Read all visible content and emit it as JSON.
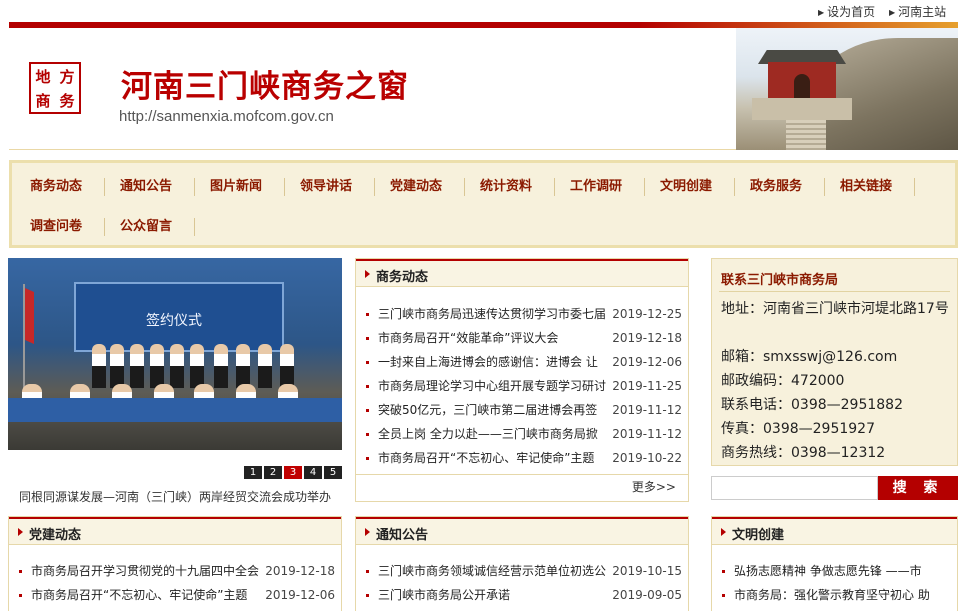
{
  "topbar": {
    "set_home": "设为首页",
    "henan_main": "河南主站"
  },
  "header": {
    "seal_chars": [
      "地",
      "方",
      "商",
      "务"
    ],
    "title": "河南三门峡商务之窗",
    "url": "http://sanmenxia.mofcom.gov.cn"
  },
  "nav": {
    "items": [
      "商务动态",
      "通知公告",
      "图片新闻",
      "领导讲话",
      "党建动态",
      "统计资料",
      "工作调研",
      "文明创建",
      "政务服务",
      "相关链接",
      "调查问卷",
      "公众留言"
    ]
  },
  "carousel": {
    "slide_title": "签约仪式",
    "pages": [
      "1",
      "2",
      "3",
      "4",
      "5"
    ],
    "active_page": "3",
    "caption": "同根同源谋发展—河南（三门峡）两岸经贸交流会成功举办"
  },
  "business_news": {
    "title": "商务动态",
    "more": "更多>>",
    "items": [
      {
        "title": "三门峡市商务局迅速传达贯彻学习市委七届",
        "date": "2019-12-25"
      },
      {
        "title": "市商务局召开“效能革命”评议大会",
        "date": "2019-12-18"
      },
      {
        "title": "一封来自上海进博会的感谢信：进博会 让",
        "date": "2019-12-06"
      },
      {
        "title": "市商务局理论学习中心组开展专题学习研讨",
        "date": "2019-11-25"
      },
      {
        "title": "突破50亿元，三门峡市第二届进博会再签",
        "date": "2019-11-12"
      },
      {
        "title": "全员上岗 全力以赴——三门峡市商务局掀",
        "date": "2019-11-12"
      },
      {
        "title": "市商务局召开“不忘初心、牢记使命”主题",
        "date": "2019-10-22"
      }
    ]
  },
  "contact": {
    "title": "联系三门峡市商务局",
    "rows": [
      "地址：河南省三门峡市河堤北路17号",
      "邮箱：smxsswj@126.com",
      "邮政编码：472000",
      "联系电话：0398—2951882",
      "传真：0398—2951927",
      "商务热线：0398—12312"
    ]
  },
  "search": {
    "button": "搜 索",
    "placeholder": ""
  },
  "party_news": {
    "title": "党建动态",
    "items": [
      {
        "title": "市商务局召开学习贯彻党的十九届四中全会",
        "date": "2019-12-18"
      },
      {
        "title": "市商务局召开“不忘初心、牢记使命”主题",
        "date": "2019-12-06"
      }
    ]
  },
  "notices": {
    "title": "通知公告",
    "items": [
      {
        "title": "三门峡市商务领域诚信经营示范单位初选公",
        "date": "2019-10-15"
      },
      {
        "title": "三门峡市商务局公开承诺",
        "date": "2019-09-05"
      }
    ]
  },
  "civilization": {
    "title": "文明创建",
    "items": [
      {
        "title": "弘扬志愿精神 争做志愿先锋 ——市",
        "date": ""
      },
      {
        "title": "市商务局：强化警示教育坚守初心 助",
        "date": ""
      }
    ]
  },
  "colors": {
    "brand_red": "#b40000",
    "nav_text": "#8b1a00",
    "panel_bg": "#f7f1dc",
    "border_gold": "#e6d8aa"
  }
}
